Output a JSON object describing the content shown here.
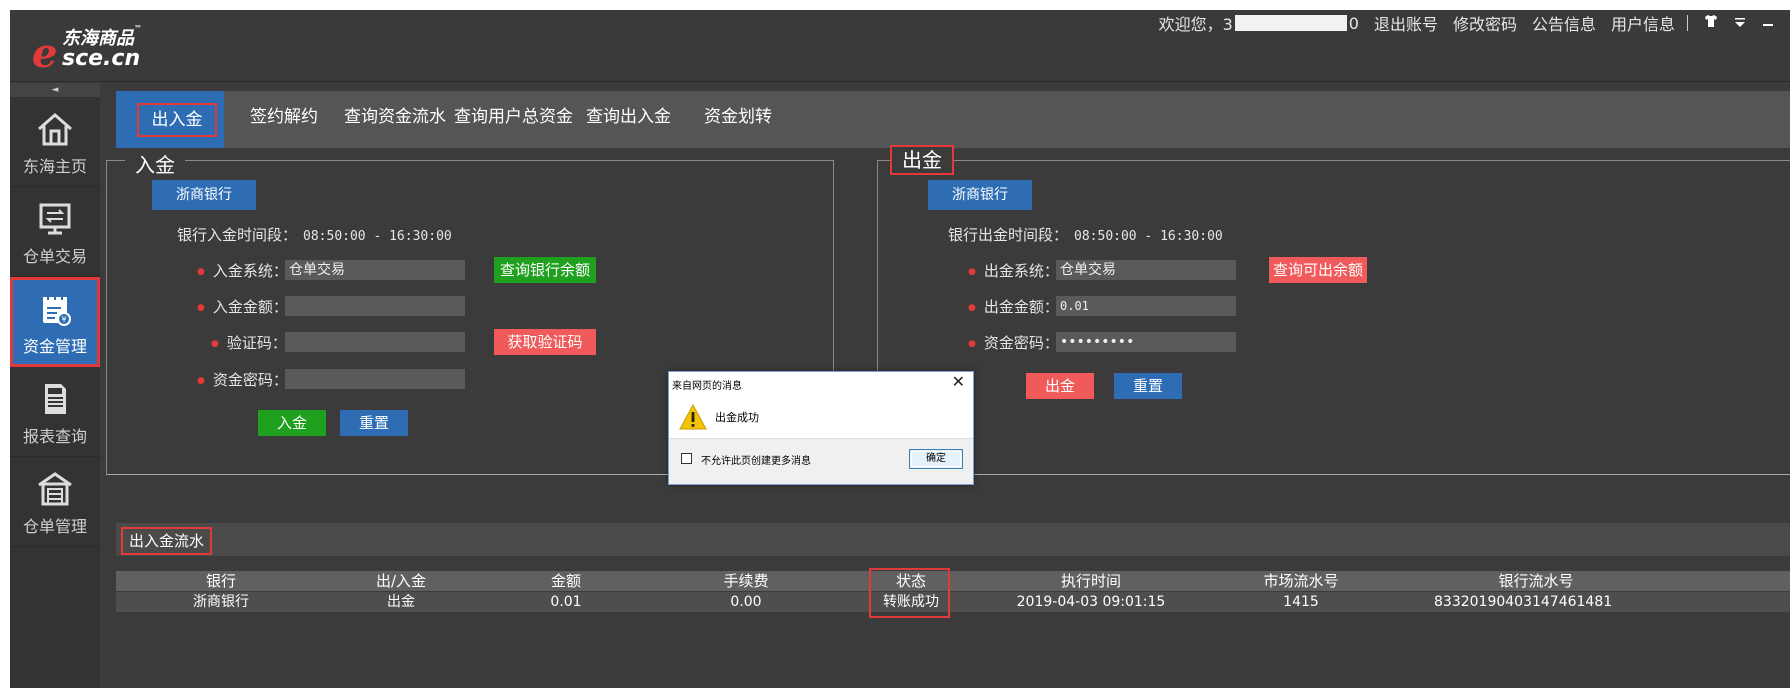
{
  "header": {
    "brand_cn": "东海商品",
    "brand_tm": "™",
    "brand_e": "e",
    "brand_domain": "sce.cn",
    "welcome": "欢迎您，3",
    "welcome_tail": "0",
    "links": [
      "退出账号",
      "修改密码",
      "公告信息",
      "用户信息"
    ],
    "icons": [
      "shirt-icon",
      "dropdown-icon",
      "minimize-icon"
    ]
  },
  "sidebar": {
    "collapse": "◄",
    "items": [
      {
        "label": "东海主页",
        "icon": "home-icon"
      },
      {
        "label": "仓单交易",
        "icon": "monitor-exchange-icon"
      },
      {
        "label": "资金管理",
        "icon": "fund-calendar-icon"
      },
      {
        "label": "报表查询",
        "icon": "report-document-icon"
      },
      {
        "label": "仓单管理",
        "icon": "warehouse-icon"
      }
    ]
  },
  "tabs": [
    "出入金",
    "签约解约",
    "查询资金流水",
    "查询用户总资金",
    "查询出入金",
    "资金划转"
  ],
  "deposit": {
    "title": "入金",
    "bank": "浙商银行",
    "time_label": "银行入金时间段：",
    "time_value": "08:50:00 - 16:30:00",
    "system_label": "入金系统：",
    "system_value": "仓单交易",
    "amount_label": "入金金额：",
    "amount_value": "",
    "captcha_label": "验证码：",
    "captcha_value": "",
    "password_label": "资金密码：",
    "password_value": "",
    "query_btn": "查询银行余额",
    "captcha_btn": "获取验证码",
    "submit_btn": "入金",
    "reset_btn": "重置"
  },
  "withdraw": {
    "title": "出金",
    "bank": "浙商银行",
    "time_label": "银行出金时间段：",
    "time_value": "08:50:00 - 16:30:00",
    "system_label": "出金系统：",
    "system_value": "仓单交易",
    "amount_label": "出金金额：",
    "amount_value": "0.01",
    "password_label": "资金密码：",
    "password_value": "•••••••••",
    "query_btn": "查询可出余额",
    "submit_btn": "出金",
    "reset_btn": "重置"
  },
  "dialog": {
    "title": "来自网页的消息",
    "close": "✕",
    "message": "出金成功",
    "checkbox_label": "不允许此页创建更多消息",
    "ok": "确定"
  },
  "flow": {
    "title": "出入金流水",
    "columns": [
      "银行",
      "出/入金",
      "金额",
      "手续费",
      "状态",
      "执行时间",
      "市场流水号",
      "银行流水号"
    ],
    "rows": [
      [
        "浙商银行",
        "出金",
        "0.01",
        "0.00",
        "转账成功",
        "2019-04-03 09:01:15",
        "1415",
        "83320190403147461481"
      ]
    ]
  },
  "colors": {
    "highlight": "#e23a3a",
    "primary_blue": "#2e6db4",
    "success_green": "#1fa01f",
    "danger_red": "#f05a5a"
  }
}
